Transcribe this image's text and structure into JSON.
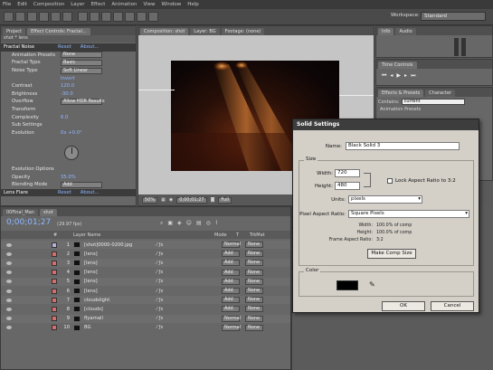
{
  "menu": [
    "File",
    "Edit",
    "Composition",
    "Layer",
    "Effect",
    "Animation",
    "View",
    "Window",
    "Help"
  ],
  "workspace": {
    "label": "Workspace:",
    "value": "Standard"
  },
  "project_panel": {
    "tabs": [
      "Project",
      "Effect Controls: Fractal..."
    ],
    "subtitle": "shot * lens",
    "rows": [
      {
        "label": "Fractal Noise",
        "value": "Reset",
        "extra": "About..."
      },
      {
        "label": "Animation Presets",
        "value": "None"
      },
      {
        "label": "Fractal Type",
        "value": "Basic"
      },
      {
        "label": "Noise Type",
        "value": "Soft Linear"
      },
      {
        "label": "",
        "value": "Invert"
      },
      {
        "label": "Contrast",
        "value": "120.0"
      },
      {
        "label": "Brightness",
        "value": "-30.0"
      },
      {
        "label": "Overflow",
        "value": "Allow HDR Results"
      },
      {
        "label": "Transform",
        "value": ""
      },
      {
        "label": "Complexity",
        "value": "6.0"
      },
      {
        "label": "Sub Settings",
        "value": ""
      },
      {
        "label": "Evolution",
        "value": "0x +0.0°"
      }
    ],
    "rows2": [
      {
        "label": "Evolution Options",
        "value": ""
      },
      {
        "label": "Opacity",
        "value": "35.0%"
      },
      {
        "label": "Blending Mode",
        "value": "Add"
      },
      {
        "label": "Lens Flare",
        "value": "Reset",
        "extra": "About..."
      }
    ]
  },
  "viewer": {
    "tabs": [
      "Composition: shot",
      "Layer: BG",
      "Footage: (none)"
    ],
    "zoom": "50%",
    "timecode": "0;00;01;27",
    "quality": "Full"
  },
  "right_panels": {
    "info_tabs": [
      "Info",
      "Audio"
    ],
    "time_tab": "Time Controls",
    "effects_tabs": [
      "Effects & Presets",
      "Character"
    ],
    "contains_label": "Contains:",
    "contains_value": "current",
    "presets_item": "Animation Presets"
  },
  "timeline": {
    "tabs": [
      "00Final_Man",
      "shot"
    ],
    "timecode": "0;00;01;27",
    "fps": "(29.97 fps)",
    "columns": [
      "#",
      "Layer Name",
      "Mode",
      "T",
      "TrkMat"
    ],
    "layers": [
      {
        "num": "1",
        "name": "[shot]0000-0200.jpg",
        "color": "#b3b3d9",
        "mode": "Normal",
        "trk": "None"
      },
      {
        "num": "2",
        "name": "[lens]",
        "color": "#d86b6b",
        "mode": "Add",
        "trk": "None"
      },
      {
        "num": "3",
        "name": "[lens]",
        "color": "#d86b6b",
        "mode": "Add",
        "trk": "None"
      },
      {
        "num": "4",
        "name": "[lens]",
        "color": "#d86b6b",
        "mode": "Add",
        "trk": "None"
      },
      {
        "num": "5",
        "name": "[lens]",
        "color": "#d86b6b",
        "mode": "Add",
        "trk": "None"
      },
      {
        "num": "6",
        "name": "[lens]",
        "color": "#d86b6b",
        "mode": "Add",
        "trk": "None"
      },
      {
        "num": "7",
        "name": "cloudslight",
        "color": "#d86b6b",
        "mode": "Add",
        "trk": "None"
      },
      {
        "num": "8",
        "name": "[clouds]",
        "color": "#d86b6b",
        "mode": "Add",
        "trk": "None"
      },
      {
        "num": "9",
        "name": "flyarnall",
        "color": "#d86b6b",
        "mode": "Normal",
        "trk": "None"
      },
      {
        "num": "10",
        "name": "BG",
        "color": "#d86b6b",
        "mode": "Normal",
        "trk": "None"
      }
    ]
  },
  "dialog": {
    "title": "Solid Settings",
    "name_label": "Name:",
    "name_value": "Black Solid 3",
    "size_label": "Size",
    "width_label": "Width:",
    "width_value": "720",
    "height_label": "Height:",
    "height_value": "480",
    "lock_label": "Lock Aspect Ratio to 3:2",
    "units_label": "Units:",
    "units_value": "pixels",
    "par_label": "Pixel Aspect Ratio:",
    "par_value": "Square Pixels",
    "info_width_label": "Width:",
    "info_width": "100.0% of comp",
    "info_height_label": "Height:",
    "info_height": "100.0% of comp",
    "info_frame_label": "Frame Aspect Ratio:",
    "info_frame": "3:2",
    "make_comp_size": "Make Comp Size",
    "color_label": "Color",
    "color_value": "#000000",
    "ok": "OK",
    "cancel": "Cancel"
  }
}
